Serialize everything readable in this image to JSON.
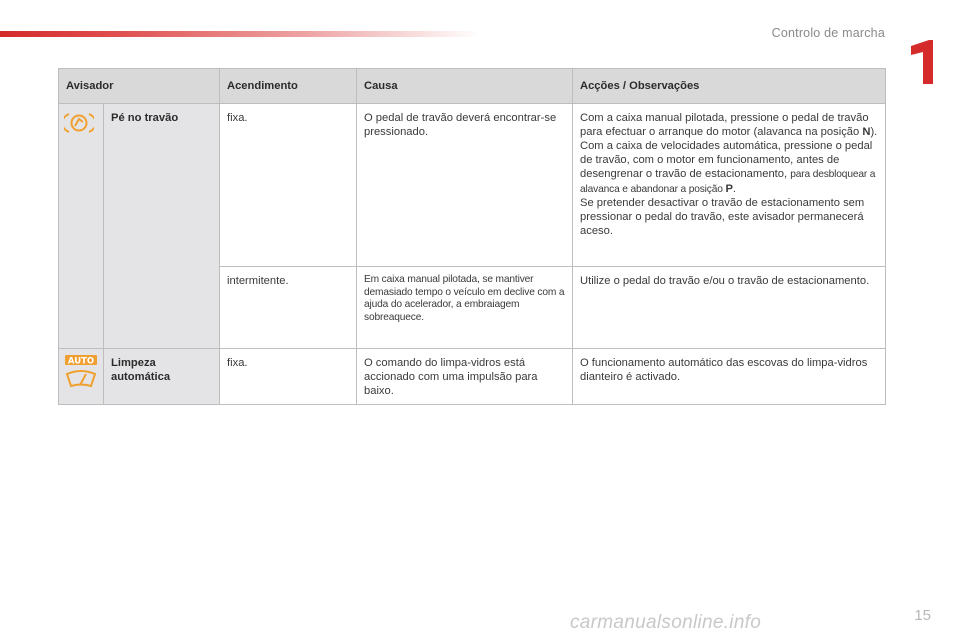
{
  "header": {
    "section_title": "Controlo de marcha",
    "chapter_number": "1"
  },
  "table": {
    "headers": {
      "warning": "Avisador",
      "lighting": "Acendimento",
      "cause": "Causa",
      "actions": "Acções / Observações"
    },
    "rows": {
      "brake_pedal": {
        "icon": "foot-on-brake-warning-icon",
        "name": "Pé no travão",
        "fixed": {
          "state": "fixa.",
          "cause": "O pedal de travão deverá encontrar-se pressionado.",
          "actions": {
            "p1": "Com a caixa manual pilotada, pressione o pedal de travão para efectuar o arranque do motor (alavanca na posição ",
            "p1_bold": "N",
            "p1_end": ").",
            "p2": "Com a caixa de velocidades automática, pressione o pedal de travão, com o motor em funcionamento, antes de desengrenar o travão de estacionamento, ",
            "p2_small": "para desbloquear a alavanca e abandonar a posição ",
            "p2_bold": "P",
            "p2_end": ".",
            "p3": "Se pretender desactivar o travão de estacionamento sem pressionar o pedal do travão, este avisador permanecerá aceso."
          }
        },
        "flashing": {
          "state": "intermitente.",
          "cause": "Em caixa manual pilotada, se mantiver demasiado tempo o veículo em declive com a ajuda do acelerador, a embraiagem sobreaquece.",
          "actions": "Utilize o pedal do travão e/ou o travão de estacionamento."
        }
      },
      "auto_wipe": {
        "icon": "automatic-wiping-icon",
        "icon_label": "AUTO",
        "name": "Limpeza automática",
        "state": "fixa.",
        "cause": "O comando do limpa-vidros está accionado com uma impulsão para baixo.",
        "actions": "O funcionamento automático das escovas do limpa-vidros dianteiro é activado."
      }
    }
  },
  "footer": {
    "page_number": "15",
    "watermark": "carmanualsonline.info"
  },
  "colors": {
    "accent_red": "#d42a2a",
    "warning_orange": "#f0a030",
    "header_gray": "#d9d9da"
  }
}
